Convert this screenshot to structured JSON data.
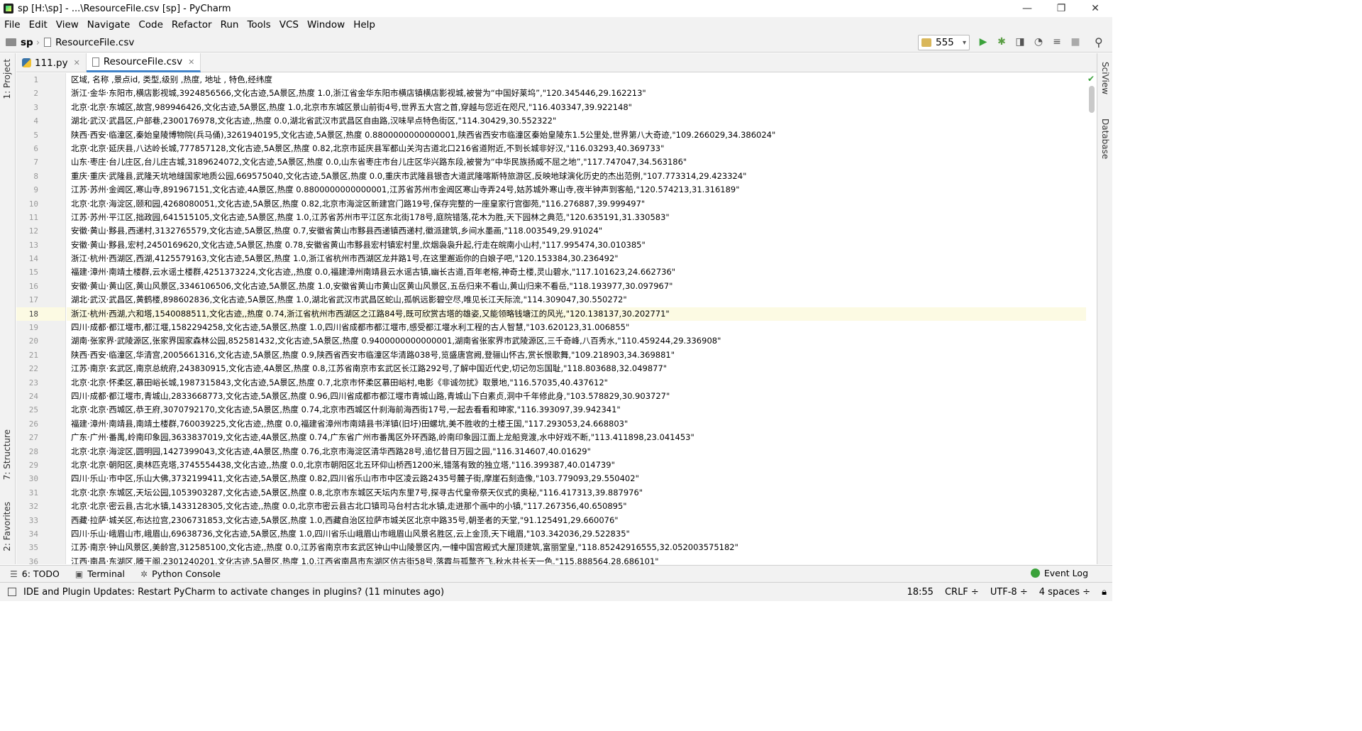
{
  "window": {
    "title": "sp [H:\\sp] - ...\\ResourceFile.csv [sp] - PyCharm",
    "minimize": "—",
    "restore": "❐",
    "close": "✕"
  },
  "menu": [
    "File",
    "Edit",
    "View",
    "Navigate",
    "Code",
    "Refactor",
    "Run",
    "Tools",
    "VCS",
    "Window",
    "Help"
  ],
  "breadcrumb": {
    "project": "sp",
    "file": "ResourceFile.csv"
  },
  "run_config": {
    "name": "555"
  },
  "left_tabs": {
    "project": "1: Project",
    "structure": "7: Structure",
    "favorites": "2: Favorites"
  },
  "right_tabs": {
    "sciview": "SciView",
    "database": "Database"
  },
  "tabs": [
    {
      "label": "111.py",
      "active": false
    },
    {
      "label": "ResourceFile.csv",
      "active": true
    }
  ],
  "editor": {
    "current_line": 18,
    "line_numbers": [
      "1",
      "2",
      "3",
      "4",
      "5",
      "6",
      "7",
      "8",
      "9",
      "10",
      "11",
      "12",
      "13",
      "14",
      "15",
      "16",
      "17",
      "18",
      "19",
      "20",
      "21",
      "22",
      "23",
      "24",
      "25",
      "26",
      "27",
      "28",
      "29",
      "30",
      "31",
      "32",
      "33",
      "34",
      "35",
      "36"
    ],
    "lines": [
      "区域,    名称 ,景点id, 类型,级别  ,热度, 地址 ,  特色,经纬度",
      "浙江·金华·东阳市,横店影视城,3924856566,文化古迹,5A景区,热度 1.0,浙江省金华东阳市横店镇横店影视城,被誉为“中国好莱坞”,\"120.345446,29.162213\"",
      "北京·北京·东城区,故宫,989946426,文化古迹,5A景区,热度 1.0,北京市东城区景山前街4号,世界五大宫之首,穿越与您近在咫尺,\"116.403347,39.922148\"",
      "湖北·武汉·武昌区,户部巷,2300176978,文化古迹,,热度 0.0,湖北省武汉市武昌区自由路,汉味早点特色街区,\"114.30429,30.552322\"",
      "陕西·西安·临潼区,秦始皇陵博物院(兵马俑),3261940195,文化古迹,5A景区,热度 0.8800000000000001,陕西省西安市临潼区秦始皇陵东1.5公里处,世界第八大奇迹,\"109.266029,34.386024\"",
      "北京·北京·延庆县,八达岭长城,777857128,文化古迹,5A景区,热度 0.82,北京市延庆县军都山关沟古道北口216省道附近,不到长城非好汉,\"116.03293,40.369733\"",
      "山东·枣庄·台儿庄区,台儿庄古城,3189624072,文化古迹,5A景区,热度 0.0,山东省枣庄市台儿庄区华兴路东段,被誉为“中华民族扬威不屈之地”,\"117.747047,34.563186\"",
      "重庆·重庆·武隆县,武隆天坑地缝国家地质公园,669575040,文化古迹,5A景区,热度 0.0,重庆市武隆县银杏大道武隆喀斯特旅游区,反映地球演化历史的杰出范例,\"107.773314,29.423324\"",
      "江苏·苏州·金阊区,寒山寺,891967151,文化古迹,4A景区,热度 0.8800000000000001,江苏省苏州市金阊区寒山寺弄24号,姑苏城外寒山寺,夜半钟声到客船,\"120.574213,31.316189\"",
      "北京·北京·海淀区,颐和园,4268080051,文化古迹,5A景区,热度 0.82,北京市海淀区新建宫门路19号,保存完整的一座皇家行宫御苑,\"116.276887,39.999497\"",
      "江苏·苏州·平江区,拙政园,641515105,文化古迹,5A景区,热度 1.0,江苏省苏州市平江区东北街178号,庭院错落,花木为胜,天下园林之典范,\"120.635191,31.330583\"",
      "安徽·黄山·黟县,西递村,3132765579,文化古迹,5A景区,热度 0.7,安徽省黄山市黟县西递镇西递村,徽派建筑,乡间水墨画,\"118.003549,29.91024\"",
      "安徽·黄山·黟县,宏村,2450169620,文化古迹,5A景区,热度 0.78,安徽省黄山市黟县宏村镇宏村里,炊烟袅袅升起,行走在皖南小山村,\"117.995474,30.010385\"",
      "浙江·杭州·西湖区,西湖,4125579163,文化古迹,5A景区,热度 1.0,浙江省杭州市西湖区龙井路1号,在这里邂逅你的白娘子吧,\"120.153384,30.236492\"",
      "福建·漳州·南靖土楼群,云水谣土楼群,4251373224,文化古迹,,热度 0.0,福建漳州南靖县云水谣古镇,幽长古道,百年老榕,神奇土楼,灵山碧水,\"117.101623,24.662736\"",
      "安徽·黄山·黄山区,黄山风景区,3346106506,文化古迹,5A景区,热度 1.0,安徽省黄山市黄山区黄山风景区,五岳归来不看山,黄山归来不看岳,\"118.193977,30.097967\"",
      "湖北·武汉·武昌区,黄鹤楼,898602836,文化古迹,5A景区,热度 1.0,湖北省武汉市武昌区蛇山,孤帆远影碧空尽,唯见长江天际流,\"114.309047,30.550272\"",
      "浙江·杭州·西湖,六和塔,1540088511,文化古迹,,热度 0.74,浙江省杭州市西湖区之江路84号,既可欣赏古塔的雄姿,又能领略钱塘江的风光,\"120.138137,30.202771\"",
      "四川·成都·都江堰市,都江堰,1582294258,文化古迹,5A景区,热度 1.0,四川省成都市都江堰市,感受都江堰水利工程的古人智慧,\"103.620123,31.006855\"",
      "湖南·张家界·武陵源区,张家界国家森林公园,852581432,文化古迹,5A景区,热度 0.9400000000000001,湖南省张家界市武陵源区,三千奇峰,八百秀水,\"110.459244,29.336908\"",
      "陕西·西安·临潼区,华清宫,2005661316,文化古迹,5A景区,热度 0.9,陕西省西安市临潼区华清路038号,览盛唐宫阙,登骊山怀古,赏长恨歌舞,\"109.218903,34.369881\"",
      "江苏·南京·玄武区,南京总统府,243830915,文化古迹,4A景区,热度 0.8,江苏省南京市玄武区长江路292号,了解中国近代史,切记勿忘国耻,\"118.803688,32.049877\"",
      "北京·北京·怀柔区,慕田峪长城,1987315843,文化古迹,5A景区,热度 0.7,北京市怀柔区慕田峪村,电影《非诚勿扰》取景地,\"116.57035,40.437612\"",
      "四川·成都·都江堰市,青城山,2833668773,文化古迹,5A景区,热度 0.96,四川省成都市都江堰市青城山路,青城山下白素贞,洞中千年修此身,\"103.578829,30.903727\"",
      "北京·北京·西城区,恭王府,3070792170,文化古迹,5A景区,热度 0.74,北京市西城区什刹海前海西街17号,一起去看看和珅家,\"116.393097,39.942341\"",
      "福建·漳州·南靖县,南靖土楼群,760039225,文化古迹,,热度 0.0,福建省漳州市南靖县书洋镇(旧圩)田螺坑,美不胜收的土楼王国,\"117.293053,24.668803\"",
      "广东·广州·番禺,岭南印象园,3633837019,文化古迹,4A景区,热度 0.74,广东省广州市番禺区外环西路,岭南印象园江面上龙船竞渡,水中好戏不断,\"113.411898,23.041453\"",
      "北京·北京·海淀区,圆明园,1427399043,文化古迹,4A景区,热度 0.76,北京市海淀区清华西路28号,追忆昔日万园之园,\"116.314607,40.01629\"",
      "北京·北京·朝阳区,奥林匹克塔,3745554438,文化古迹,,热度 0.0,北京市朝阳区北五环仰山桥西1200米,错落有致的独立塔,\"116.399387,40.014739\"",
      "四川·乐山·市中区,乐山大佛,3732199411,文化古迹,5A景区,热度 0.82,四川省乐山市市中区凌云路2435号麓子街,摩崖石刻造像,\"103.779093,29.550402\"",
      "北京·北京·东城区,天坛公园,1053903287,文化古迹,5A景区,热度 0.8,北京市东城区天坛内东里7号,探寻古代皇帝祭天仪式的奥秘,\"116.417313,39.887976\"",
      "北京·北京·密云县,古北水镇,1433128305,文化古迹,,热度 0.0,北京市密云县古北口镇司马台村古北水镇,走进那个画中的小镇,\"117.267356,40.650895\"",
      "西藏·拉萨·城关区,布达拉宫,2306731853,文化古迹,5A景区,热度 1.0,西藏自治区拉萨市城关区北京中路35号,朝圣者的天堂,\"91.125491,29.660076\"",
      "四川·乐山·峨眉山市,峨眉山,69638736,文化古迹,5A景区,热度 1.0,四川省乐山峨眉山市峨眉山风景名胜区,云上金顶,天下峨眉,\"103.342036,29.522835\"",
      "江苏·南京·钟山风景区,美龄宫,312585100,文化古迹,,热度 0.0,江苏省南京市玄武区钟山中山陵景区内,一幢中国宫殿式大屋顶建筑,富丽堂皇,\"118.85242916555,32.052003575182\"",
      "江西·南昌·东湖区,滕王阁,2301240201,文化古迹,5A景区,热度 1.0,江西省南昌市东湖区仿古街58号,落霞与孤鹜齐飞,秋水共长天一色,\"115.888564,28.686101\""
    ]
  },
  "bottom_tools": {
    "todo": "6: TODO",
    "terminal": "Terminal",
    "python_console": "Python Console",
    "event_log": "Event Log"
  },
  "status": {
    "message": "IDE and Plugin Updates: Restart PyCharm to activate changes in plugins? (11 minutes ago)",
    "position": "18:55",
    "line_sep": "CRLF ÷",
    "encoding": "UTF-8 ÷",
    "indent": "4 spaces ÷"
  }
}
